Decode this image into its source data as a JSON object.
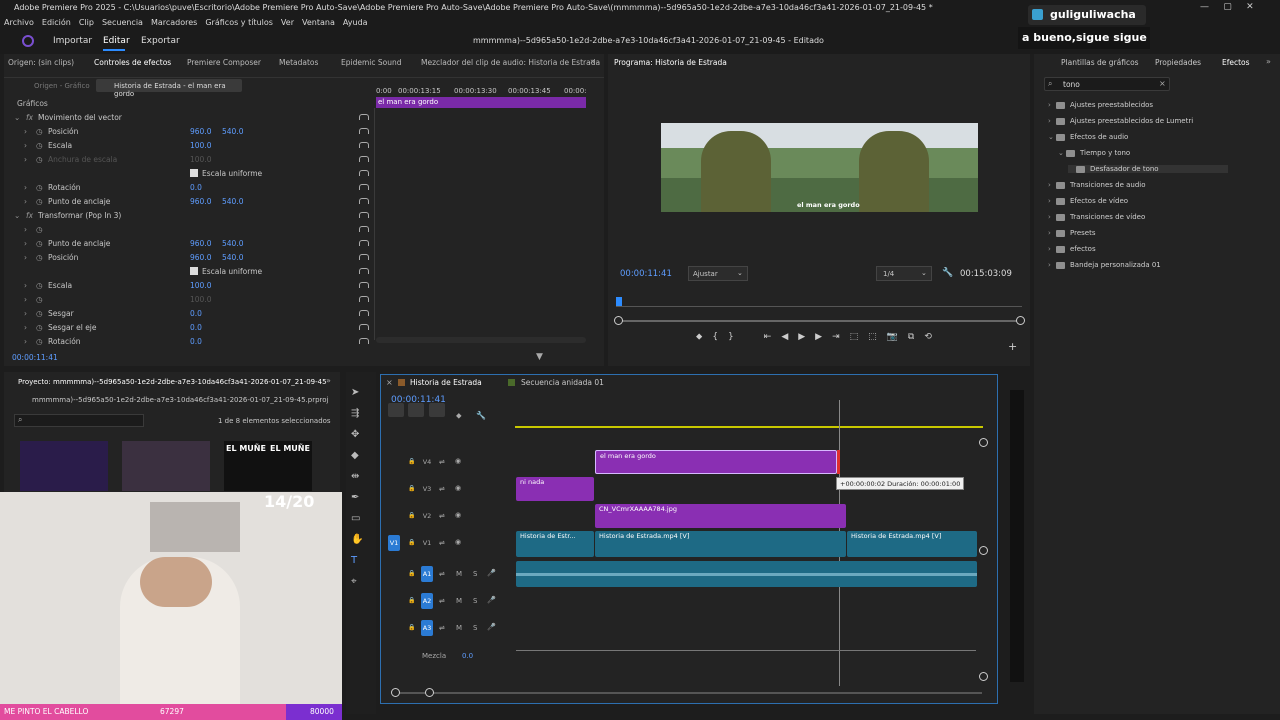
{
  "titlebar": {
    "text": "Adobe Premiere Pro 2025 - C:\\Usuarios\\puve\\Escritorio\\Adobe Premiere Pro Auto-Save\\Adobe Premiere Pro Auto-Save\\Adobe Premiere Pro Auto-Save\\(mmmmma)--5d965a50-1e2d-2dbe-a7e3-10da46cf3a41-2026-01-07_21-09-45 *"
  },
  "menu": [
    "Archivo",
    "Edición",
    "Clip",
    "Secuencia",
    "Marcadores",
    "Gráficos y títulos",
    "Ver",
    "Ventana",
    "Ayuda"
  ],
  "topbar": {
    "importar": "Importar",
    "editar": "Editar",
    "exportar": "Exportar",
    "project_title": "mmmmma)--5d965a50-1e2d-2dbe-a7e3-10da46cf3a41-2026-01-07_21-09-45 - Editado"
  },
  "overlay": {
    "channel": "guliguliwacha",
    "message": "a bueno,sigue sigue",
    "counter": "14/20",
    "bottom_text": "ME PINTO EL CABELLO",
    "points": "67297",
    "points2": "80000"
  },
  "tabs_left": [
    "Origen: (sin clips)",
    "Controles de efectos",
    "Premiere Composer",
    "Metadatos",
    "Epidemic Sound",
    "Mezclador del clip de audio: Historia de Estrada"
  ],
  "effect_controls": {
    "source": "Origen - Gráfico",
    "seq": "Historia de Estrada - el man era gordo",
    "section": "Gráficos",
    "ruler": [
      "0:00",
      "00:00:13:15",
      "00:00:13:30",
      "00:00:13:45",
      "00:00:"
    ],
    "clip_label": "el man era gordo",
    "timecode": "00:00:11:41",
    "rows": [
      {
        "label": "Movimiento del vector",
        "v1": "",
        "v2": "",
        "indent": 26
      },
      {
        "label": "Posición",
        "v1": "960.0",
        "v2": "540.0",
        "indent": 48
      },
      {
        "label": "Escala",
        "v1": "100.0",
        "v2": "",
        "indent": 48
      },
      {
        "label": "Anchura de escala",
        "v1": "100.0",
        "v2": "",
        "indent": 48,
        "dim": true
      },
      {
        "label": "Escala uniforme",
        "v1": "",
        "v2": "",
        "indent": 202,
        "check": true
      },
      {
        "label": "Rotación",
        "v1": "0.0",
        "v2": "",
        "indent": 48
      },
      {
        "label": "Punto de anclaje",
        "v1": "960.0",
        "v2": "540.0",
        "indent": 48
      },
      {
        "label": "Transformar (Pop In 3)",
        "v1": "",
        "v2": "",
        "indent": 26
      },
      {
        "label": "",
        "v1": "",
        "v2": "",
        "indent": 48
      },
      {
        "label": "Punto de anclaje",
        "v1": "960.0",
        "v2": "540.0",
        "indent": 48
      },
      {
        "label": "Posición",
        "v1": "960.0",
        "v2": "540.0",
        "indent": 48
      },
      {
        "label": "Escala uniforme",
        "v1": "",
        "v2": "",
        "indent": 202,
        "check": true
      },
      {
        "label": "Escala",
        "v1": "100.0",
        "v2": "",
        "indent": 48
      },
      {
        "label": "",
        "v1": "100.0",
        "v2": "",
        "indent": 48,
        "dim": true
      },
      {
        "label": "Sesgar",
        "v1": "0.0",
        "v2": "",
        "indent": 48
      },
      {
        "label": "Sesgar el eje",
        "v1": "0.0",
        "v2": "",
        "indent": 48
      },
      {
        "label": "Rotación",
        "v1": "0.0",
        "v2": "",
        "indent": 48
      }
    ]
  },
  "program": {
    "title": "Programa: Historia de Estrada",
    "timecode": "00:00:11:41",
    "fit": "Ajustar",
    "res": "1/4",
    "duration": "00:15:03:09",
    "subtitle": "el man era gordo"
  },
  "right_tabs": [
    "Plantillas de gráficos",
    "Propiedades",
    "Efectos"
  ],
  "effects_search": "tono",
  "effects_tree": [
    {
      "label": "Ajustes preestablecidos",
      "level": 0
    },
    {
      "label": "Ajustes preestablecidos de Lumetri",
      "level": 0
    },
    {
      "label": "Efectos de audio",
      "level": 0,
      "open": true
    },
    {
      "label": "Tiempo y tono",
      "level": 1,
      "open": true
    },
    {
      "label": "Desfasador de tono",
      "level": 2,
      "selected": true
    },
    {
      "label": "Transiciones de audio",
      "level": 0
    },
    {
      "label": "Efectos de vídeo",
      "level": 0
    },
    {
      "label": "Transiciones de vídeo",
      "level": 0
    },
    {
      "label": "Presets",
      "level": 0
    },
    {
      "label": "efectos",
      "level": 0
    },
    {
      "label": "Bandeja personalizada 01",
      "level": 0
    }
  ],
  "project": {
    "title": "Proyecto: mmmmma)--5d965a50-1e2d-2dbe-a7e3-10da46cf3a41-2026-01-07_21-09-45",
    "file": "mmmmma)--5d965a50-1e2d-2dbe-a7e3-10da46cf3a41-2026-01-07_21-09-45.prproj",
    "count": "1 de 8 elementos seleccionados",
    "thumb_text": "EL MUÑE"
  },
  "timeline": {
    "tab1": "Historia de Estrada",
    "tab2": "Secuencia anidada 01",
    "timecode": "00:00:11:41",
    "tracks": [
      "V4",
      "V3",
      "V2",
      "V1",
      "A1",
      "A2",
      "A3"
    ],
    "src_v": "V1",
    "src_a": "A1",
    "mix_label": "Mezcla",
    "mix_val": "0.0",
    "clips": {
      "v4": "el man era gordo",
      "v3": "ni nada",
      "v2": "CN_VCmrXAAAA784.jpg",
      "v1a": "Historia de Estr...",
      "v1b": "Historia de Estrada.mp4 [V]",
      "v1c": "Historia de Estrada.mp4 [V]"
    },
    "tooltip": "+00:00:00:02 Duración: 00:00:01:00"
  }
}
